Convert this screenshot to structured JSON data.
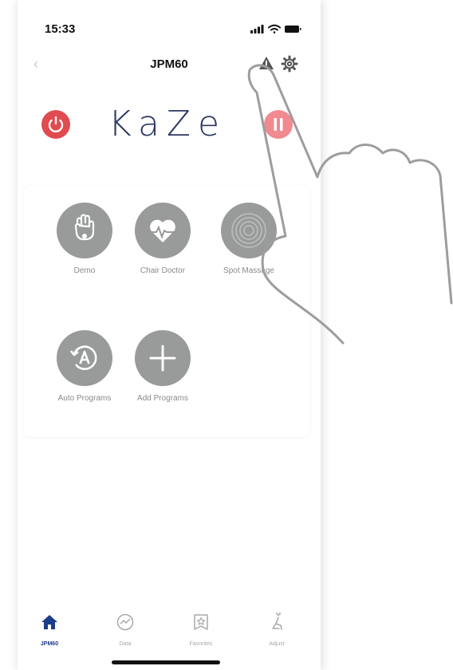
{
  "status_bar": {
    "time": "15:33"
  },
  "nav": {
    "back_glyph": "‹",
    "title": "JPM60",
    "warning_icon": "warning-icon",
    "settings_icon": "gear-icon"
  },
  "brand": {
    "logo_text": "KaZe",
    "power_icon": "power-icon",
    "pause_icon": "pause-icon"
  },
  "colors": {
    "power": "#e04b50",
    "pause": "#f08a90",
    "tile": "#999a9a",
    "brand_text": "#2c3660",
    "active_tab": "#1c3d8a",
    "inactive_tab": "#a8a8a8"
  },
  "grid": {
    "items": [
      {
        "label": "Demo",
        "icon": "hand-icon"
      },
      {
        "label": "Chair Doctor",
        "icon": "heart-pulse-icon"
      },
      {
        "label": "Spot Massage",
        "icon": "target-rings-icon"
      },
      {
        "label": "Auto Programs",
        "icon": "auto-a-icon"
      },
      {
        "label": "Add Programs",
        "icon": "plus-icon"
      }
    ]
  },
  "tabs": [
    {
      "label": "JPM60",
      "icon": "home-icon",
      "active": true
    },
    {
      "label": "Data",
      "icon": "chart-circle-icon",
      "active": false
    },
    {
      "label": "Favorites",
      "icon": "star-bookmark-icon",
      "active": false
    },
    {
      "label": "Adjust",
      "icon": "seat-adjust-icon",
      "active": false
    }
  ],
  "overlay": {
    "icon": "pointing-hand-icon"
  }
}
